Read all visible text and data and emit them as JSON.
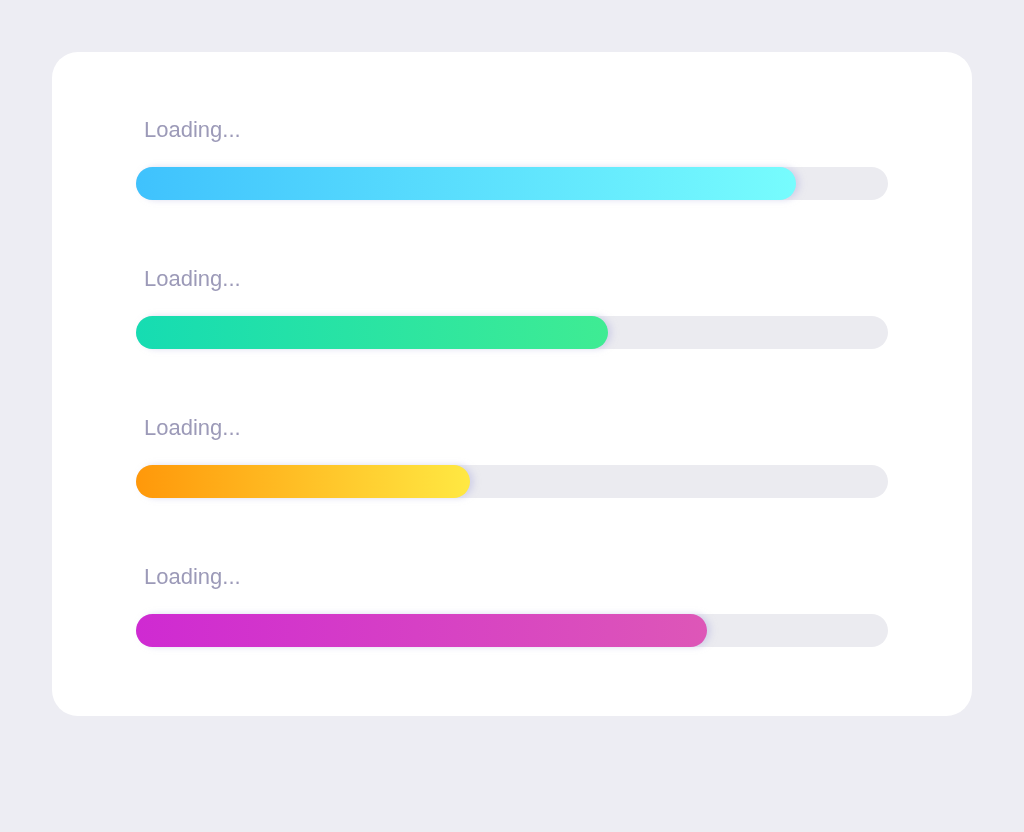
{
  "progress_bars": [
    {
      "label": "Loading...",
      "level": 0.878,
      "color": "#3fc2fd"
    },
    {
      "label": "Loading...",
      "level": 0.628,
      "color": "#16dcb2"
    },
    {
      "label": "Loading...",
      "level": 0.444,
      "color": "#ff980a"
    },
    {
      "label": "Loading...",
      "level": 0.759,
      "color": "#cf2ad2"
    }
  ]
}
